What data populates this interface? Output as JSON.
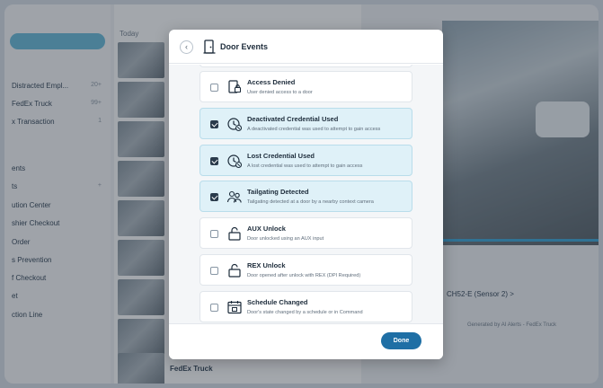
{
  "background": {
    "sidebar_items": [
      {
        "label": "Distracted Empl... ",
        "count": "20+"
      },
      {
        "label": "FedEx Truck ",
        "count": "99+"
      },
      {
        "label": "x Transaction ",
        "count": "1"
      },
      {
        "label": "ents",
        "count": ""
      },
      {
        "label": "ts",
        "count": "+"
      },
      {
        "label": "ution Center",
        "count": ""
      },
      {
        "label": "shier Checkout",
        "count": ""
      },
      {
        "label": "Order",
        "count": ""
      },
      {
        "label": "s Prevention",
        "count": ""
      },
      {
        "label": "f Checkout",
        "count": ""
      },
      {
        "label": "et",
        "count": ""
      },
      {
        "label": "ction Line",
        "count": ""
      }
    ],
    "today_label": "Today",
    "bottom_label": "FedEx Truck",
    "camera_label": "CH52-E (Sensor 2) >",
    "generated_label": "Generated by AI Alerts - FedEx Truck"
  },
  "modal": {
    "title": "Door Events",
    "done_label": "Done",
    "items": [
      {
        "title": "Access Denied",
        "desc": "User denied access to a door",
        "checked": false,
        "icon": "door-lock-icon"
      },
      {
        "title": "Deactivated Credential Used",
        "desc": "A deactivated credential was used to attempt to gain access",
        "checked": true,
        "icon": "credential-clock-icon"
      },
      {
        "title": "Lost Credential Used",
        "desc": "A lost credential was used to attempt to gain access",
        "checked": true,
        "icon": "credential-clock-icon"
      },
      {
        "title": "Tailgating Detected",
        "desc": "Tailgating detected at a door by a nearby context camera",
        "checked": true,
        "icon": "people-icon"
      },
      {
        "title": "AUX Unlock",
        "desc": "Door unlocked using an AUX input",
        "checked": false,
        "icon": "unlock-icon"
      },
      {
        "title": "REX Unlock",
        "desc": "Door opened after unlock with REX (DPI Required)",
        "checked": false,
        "icon": "unlock-icon"
      },
      {
        "title": "Schedule Changed",
        "desc": "Door's state changed by a schedule or in Command",
        "checked": false,
        "icon": "calendar-icon"
      }
    ]
  }
}
